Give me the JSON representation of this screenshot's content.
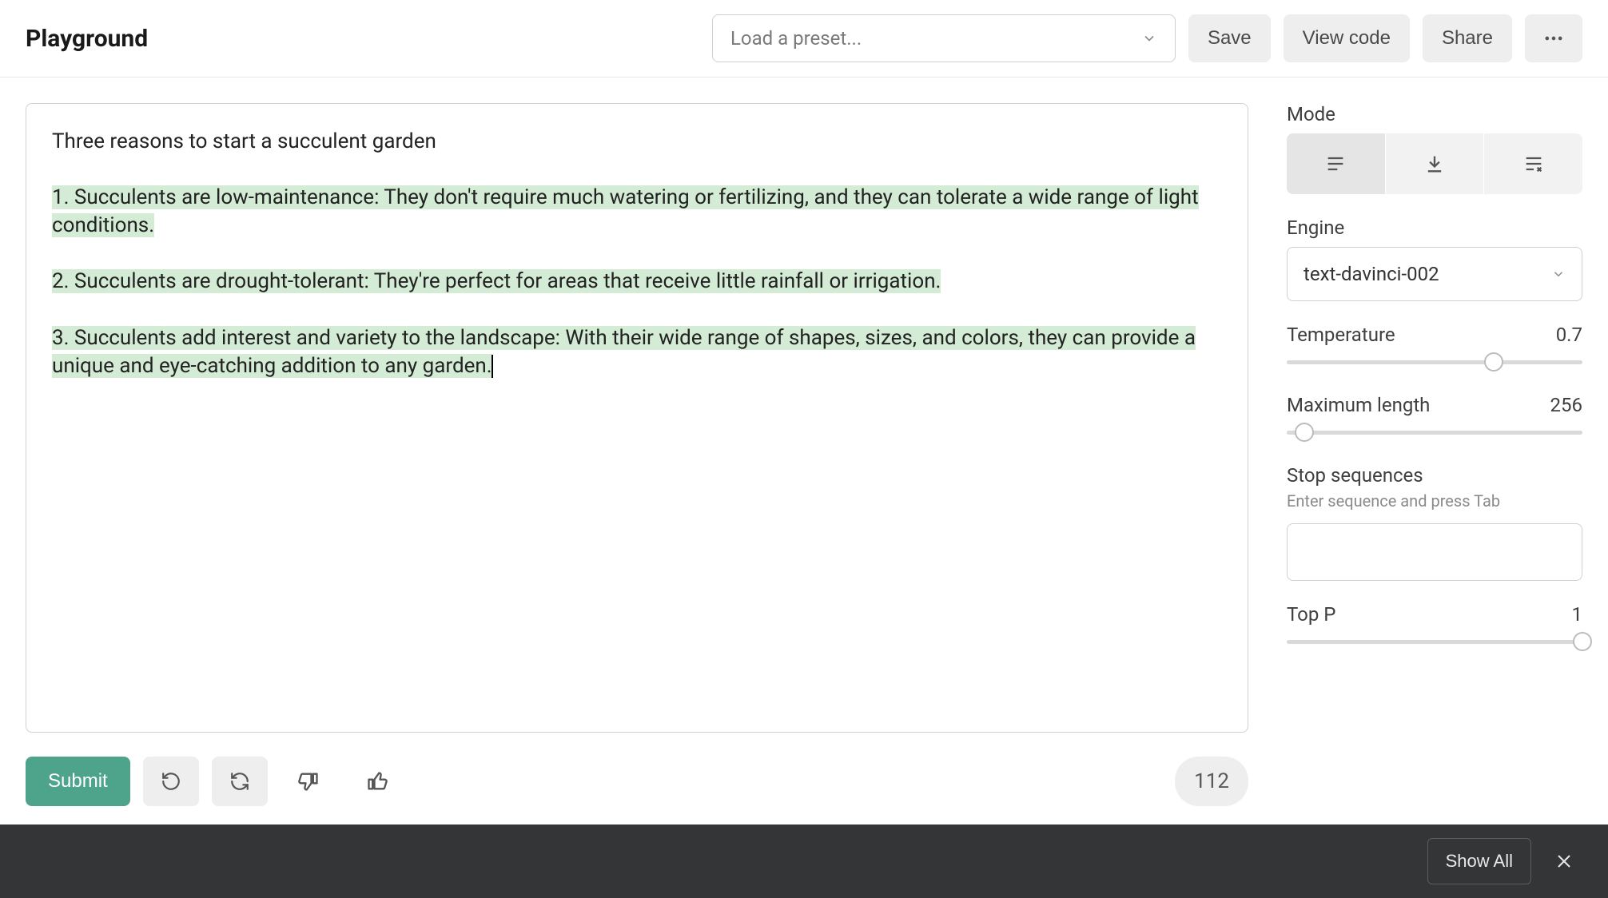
{
  "header": {
    "title": "Playground",
    "preset_placeholder": "Load a preset...",
    "save_label": "Save",
    "view_code_label": "View code",
    "share_label": "Share"
  },
  "editor": {
    "prompt": "Three reasons to start a succulent garden",
    "lines": [
      "1. Succulents are low-maintenance: They don't require much watering or fertilizing, and they can tolerate a wide range of light conditions.",
      "2. Succulents are drought-tolerant: They're perfect for areas that receive little rainfall or irrigation.",
      "3. Succulents add interest and variety to the landscape: With their wide range of shapes, sizes, and colors, they can provide a unique and eye-catching addition to any garden."
    ]
  },
  "actions": {
    "submit_label": "Submit",
    "token_count": "112"
  },
  "sidebar": {
    "mode_label": "Mode",
    "engine_label": "Engine",
    "engine_value": "text-davinci-002",
    "temperature_label": "Temperature",
    "temperature_value": "0.7",
    "temperature_pct": 70,
    "maxlen_label": "Maximum length",
    "maxlen_value": "256",
    "maxlen_pct": 6,
    "stop_label": "Stop sequences",
    "stop_hint": "Enter sequence and press Tab",
    "topp_label": "Top P",
    "topp_value": "1",
    "topp_pct": 100
  },
  "footer": {
    "show_all_label": "Show All"
  }
}
